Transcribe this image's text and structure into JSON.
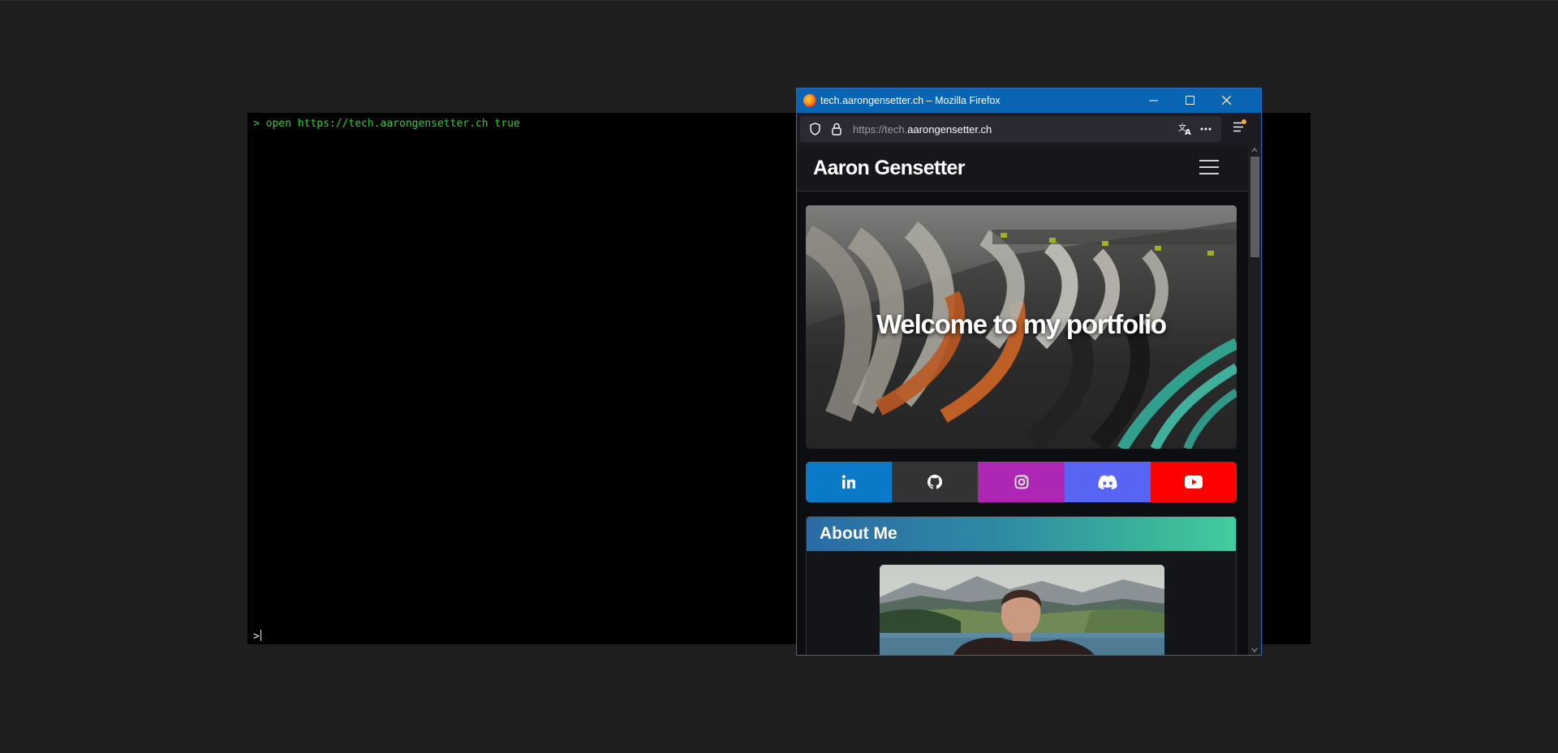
{
  "terminal": {
    "command_line": "> open https://tech.aarongensetter.ch true",
    "prompt": ">"
  },
  "browser": {
    "window_title": "tech.aarongensetter.ch – Mozilla Firefox",
    "url_prefix": "https://tech.",
    "url_host": "aarongensetter.ch",
    "icons": [
      "firefox-icon",
      "minimize-icon",
      "maximize-icon",
      "close-icon",
      "shield-icon",
      "lock-icon",
      "translate-icon",
      "more-icon",
      "menu-icon"
    ],
    "accent_color": "#0a64b4"
  },
  "site": {
    "brand": "Aaron Gensetter",
    "hero_title": "Welcome to my portfolio",
    "socials": [
      {
        "name": "LinkedIn",
        "icon": "linkedin-icon",
        "color": "#0a7ac8"
      },
      {
        "name": "GitHub",
        "icon": "github-icon",
        "color": "#333333"
      },
      {
        "name": "Instagram",
        "icon": "instagram-icon",
        "color": "#ad27b4"
      },
      {
        "name": "Discord",
        "icon": "discord-icon",
        "color": "#5865f2"
      },
      {
        "name": "YouTube",
        "icon": "youtube-icon",
        "color": "#ff0000"
      }
    ],
    "about_title": "About Me"
  }
}
